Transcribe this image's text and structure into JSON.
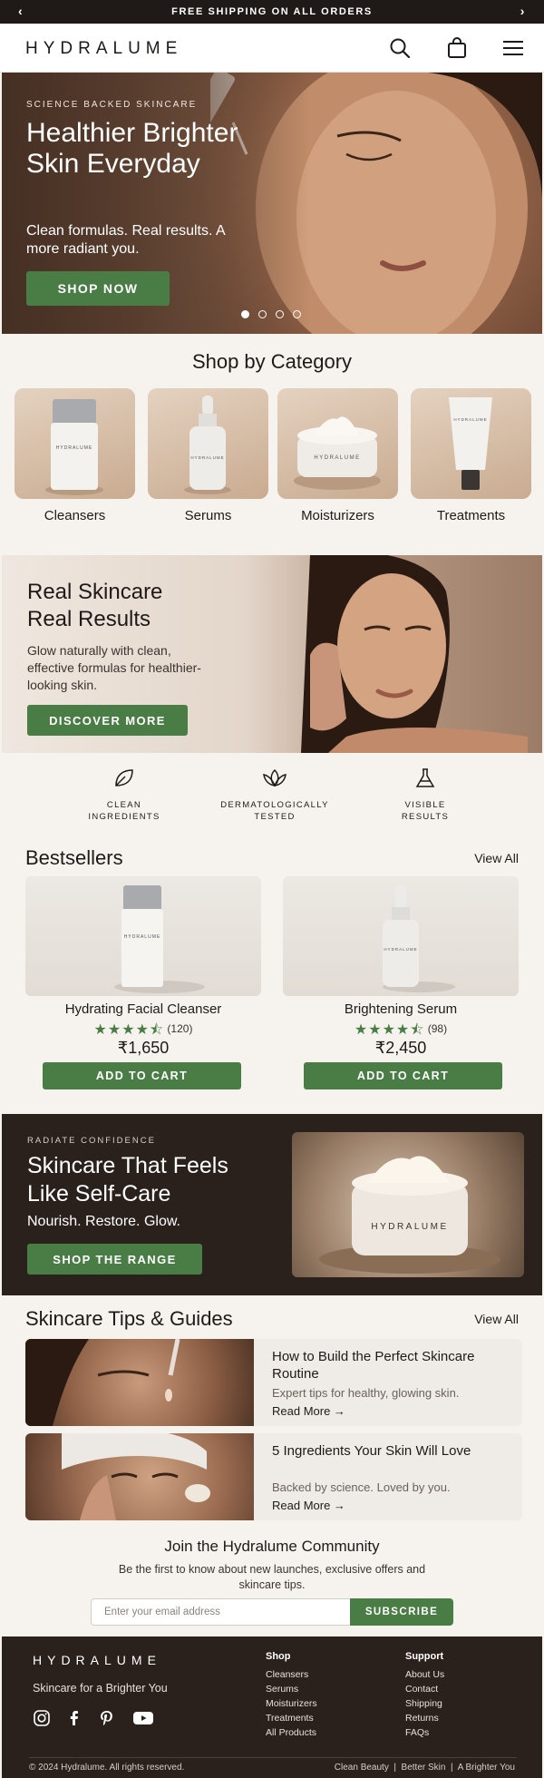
{
  "announcement": {
    "text": "FREE SHIPPING ON ALL ORDERS",
    "prev": "‹",
    "next": "›"
  },
  "header": {
    "logo": "HYDRALUME"
  },
  "hero": {
    "eyebrow": "SCIENCE BACKED SKINCARE",
    "title": "Healthier Brighter Skin Everyday",
    "subtitle": "Clean formulas. Real results. A more radiant you.",
    "cta": "SHOP NOW",
    "slides_total": 4,
    "active_slide": 1
  },
  "categories": {
    "title": "Shop by Category",
    "items": [
      {
        "label": "Cleansers",
        "product_text": "HYDRALUME"
      },
      {
        "label": "Serums",
        "product_text": "HYDRALUME"
      },
      {
        "label": "Moisturizers",
        "product_text": "HYDRALUME"
      },
      {
        "label": "Treatments",
        "product_text": "HYDRALUME"
      }
    ]
  },
  "banner": {
    "title": "Real Skincare Real Results",
    "subtitle": "Glow naturally with clean, effective formulas for healthier-looking skin.",
    "cta": "DISCOVER MORE"
  },
  "features": [
    {
      "icon": "leaf-icon",
      "label": "CLEAN INGREDIENTS"
    },
    {
      "icon": "lotus-icon",
      "label": "DERMATOLOGICALLY TESTED"
    },
    {
      "icon": "flask-icon",
      "label": "VISIBLE RESULTS"
    }
  ],
  "bestsellers": {
    "title": "Bestsellers",
    "view_all": "View All",
    "products": [
      {
        "name": "Hydrating Facial Cleanser",
        "rating": 4.5,
        "reviews": "(120)",
        "price": "₹1,650",
        "cta": "ADD TO CART",
        "brand": "HYDRALUME"
      },
      {
        "name": "Brightening Serum",
        "rating": 4.5,
        "reviews": "(98)",
        "price": "₹2,450",
        "cta": "ADD TO CART",
        "brand": "HYDRALUME"
      }
    ]
  },
  "promo": {
    "eyebrow": "RADIATE CONFIDENCE",
    "title": "Skincare That Feels Like Self-Care",
    "subtitle": "Nourish. Restore. Glow.",
    "cta": "SHOP THE RANGE",
    "jar_brand": "HYDRALUME"
  },
  "tips": {
    "title": "Skincare Tips & Guides",
    "view_all": "View All",
    "items": [
      {
        "title": "How to Build the Perfect Skincare Routine",
        "desc": "Expert tips for healthy, glowing skin.",
        "link": "Read More →"
      },
      {
        "title": "5 Ingredients Your Skin Will Love",
        "desc": "Backed by science. Loved by you.",
        "link": "Read More →"
      }
    ]
  },
  "newsletter": {
    "title": "Join the Hydralume Community",
    "subtitle": "Be the first to know about new launches, exclusive offers and skincare tips.",
    "placeholder": "Enter your email address",
    "cta": "SUBSCRIBE"
  },
  "footer": {
    "logo": "HYDRALUME",
    "tagline": "Skincare for a Brighter You",
    "shop_heading": "Shop",
    "shop_links": [
      "Cleansers",
      "Serums",
      "Moisturizers",
      "Treatments",
      "All Products"
    ],
    "support_heading": "Support",
    "support_links": [
      "About Us",
      "Contact",
      "Shipping",
      "Returns",
      "FAQs"
    ],
    "copyright": "© 2024 Hydralume. All rights reserved.",
    "bottom_links": "Clean Beauty  |  Better Skin  |  A Brighter You",
    "social": [
      "instagram-icon",
      "facebook-icon",
      "pinterest-icon",
      "youtube-icon"
    ]
  },
  "colors": {
    "accent": "#4a7d46",
    "dark": "#2a211d",
    "background": "#f6f3ef"
  }
}
